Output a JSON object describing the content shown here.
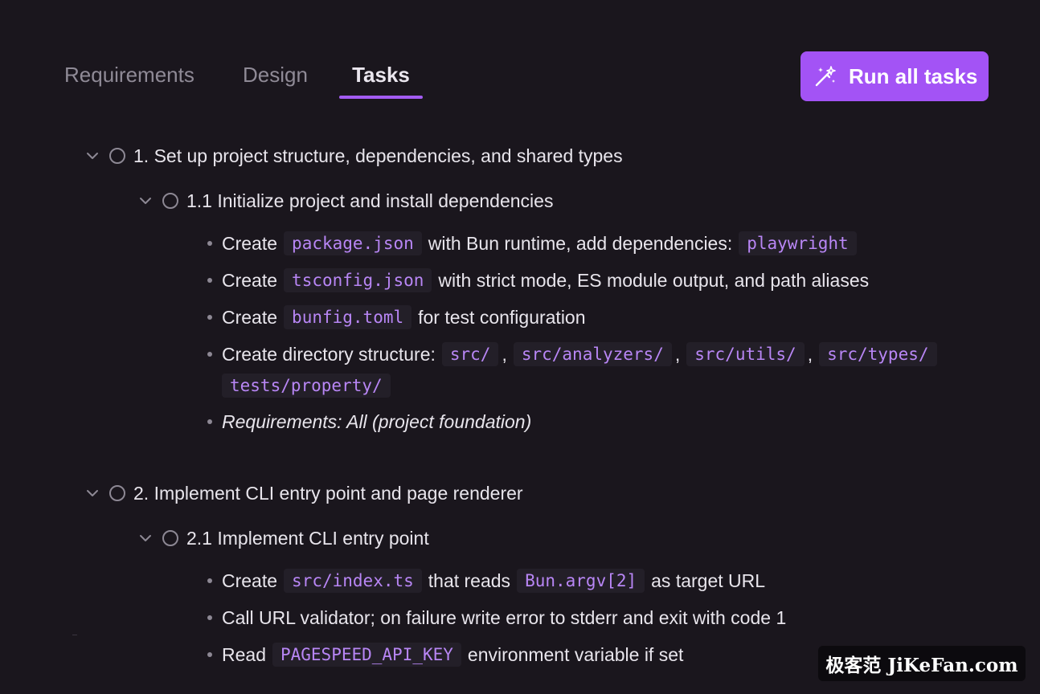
{
  "tabs": [
    {
      "label": "Requirements",
      "active": false
    },
    {
      "label": "Design",
      "active": false
    },
    {
      "label": "Tasks",
      "active": true
    }
  ],
  "run_button": {
    "label": "Run all tasks",
    "icon": "magic-wand-icon"
  },
  "tasks": {
    "t1": {
      "title": "1. Set up project structure, dependencies, and shared types"
    },
    "t1_1": {
      "title": "1.1 Initialize project and install dependencies",
      "b1": {
        "pre": "Create",
        "code1": "package.json",
        "mid": "with Bun runtime, add dependencies:",
        "code2": "playwright"
      },
      "b2": {
        "pre": "Create",
        "code1": "tsconfig.json",
        "post": "with strict mode, ES module output, and path aliases"
      },
      "b3": {
        "pre": "Create",
        "code1": "bunfig.toml",
        "post": "for test configuration"
      },
      "b4": {
        "pre": "Create directory structure:",
        "c1": "src/",
        "sep": ",",
        "c2": "src/analyzers/",
        "c3": "src/utils/",
        "c4": "src/types/",
        "c5": "tests/property/"
      },
      "b5": {
        "text": "Requirements: All (project foundation)"
      }
    },
    "t2": {
      "title": "2. Implement CLI entry point and page renderer"
    },
    "t2_1": {
      "title": "2.1 Implement CLI entry point",
      "b1": {
        "pre": "Create",
        "code1": "src/index.ts",
        "mid": "that reads",
        "code2": "Bun.argv[2]",
        "post": "as target URL"
      },
      "b2": {
        "text": "Call URL validator; on failure write error to stderr and exit with code 1"
      },
      "b3": {
        "pre": "Read",
        "code1": "PAGESPEED_API_KEY",
        "post": "environment variable if set"
      }
    }
  },
  "watermark": {
    "text": "极客范 JiKeFan.com"
  },
  "colors": {
    "accent": "#a353f5",
    "code": "#b886f5",
    "background": "#1a161d"
  }
}
